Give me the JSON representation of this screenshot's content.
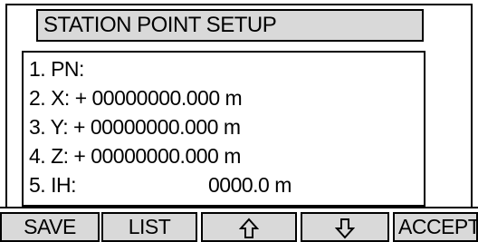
{
  "screen": {
    "title": "STATION POINT SETUP",
    "fields": [
      {
        "label": "1. PN:",
        "value": ""
      },
      {
        "label": "2. X: + 00000000.000 m"
      },
      {
        "label": "3. Y: + 00000000.000 m"
      },
      {
        "label": "4. Z: + 00000000.000 m"
      },
      {
        "label": "5. IH:",
        "value": "0000.0 m"
      }
    ]
  },
  "softkeys": [
    {
      "label": "SAVE"
    },
    {
      "label": "LIST"
    },
    {
      "label": "",
      "icon": "arrow-up-icon"
    },
    {
      "label": "",
      "icon": "arrow-down-icon"
    },
    {
      "label": "ACCEPT"
    }
  ]
}
